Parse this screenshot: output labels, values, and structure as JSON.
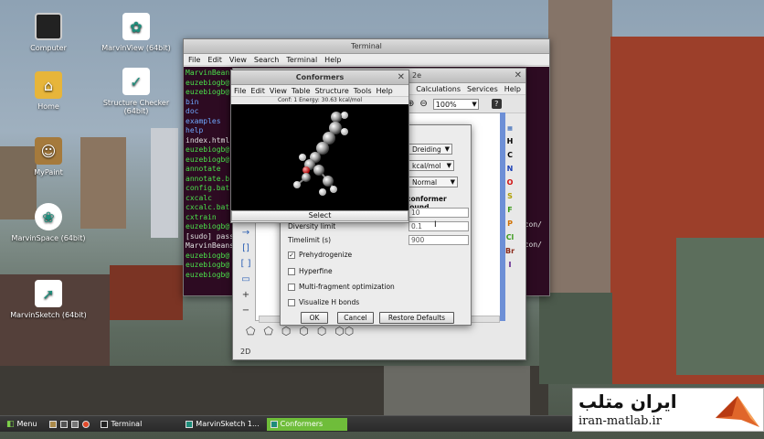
{
  "desktop_icons": [
    {
      "label": "Computer",
      "icon": "monitor-icon"
    },
    {
      "label": "MarvinView (64bit)",
      "icon": "marvinview-icon"
    },
    {
      "label": "Home",
      "icon": "folder-home-icon"
    },
    {
      "label": "Structure Checker (64bit)",
      "icon": "structure-checker-icon"
    },
    {
      "label": "MyPaint",
      "icon": "mypaint-icon"
    },
    {
      "label": "MarvinSpace (64bit)",
      "icon": "marvinspace-icon"
    },
    {
      "label": "MarvinSketch (64bit)",
      "icon": "marvinsketch-icon"
    }
  ],
  "terminal": {
    "title": "Terminal",
    "menu": [
      "File",
      "Edit",
      "View",
      "Search",
      "Terminal",
      "Help"
    ],
    "lines": [
      "MarvinBeans",
      "euzebiogb@",
      "euzebiogb@",
      "bin",
      "doc",
      "examples",
      "help",
      "index.html",
      "euzebiogb@",
      "euzebiogb@",
      "annotate",
      "annotate.b",
      "config.bat",
      "cxcalc",
      "cxcalc.bat",
      "cxtrain",
      "euzebiogb@",
      "[sudo] pass",
      "MarvinBeans",
      "euzebiogb@",
      "euzebiogb@",
      "euzebiogb@"
    ],
    "right_fragments": [
      "con/",
      "con/"
    ]
  },
  "marvinsketch": {
    "title_fragment": "2e",
    "menu_visible": [
      "Calculations",
      "Services",
      "Help"
    ],
    "zoom": "100%",
    "status_mode": "2D",
    "periodic_elements": [
      "H",
      "C",
      "N",
      "O",
      "S",
      "F",
      "P",
      "Cl",
      "Br",
      "I"
    ],
    "periodic_colors": [
      "#000000",
      "#000000",
      "#1a3fb5",
      "#d01010",
      "#b0a000",
      "#3a9a1a",
      "#d07000",
      "#3a9a1a",
      "#8a2a1a",
      "#5a1a8a"
    ]
  },
  "options": {
    "forcefield": "Dreiding",
    "energy_unit": "kcal/mol",
    "optimization": "Normal",
    "conformer_label": "conformer found",
    "max_conformers_value": "10",
    "diversity_label": "Diversity limit",
    "diversity_value": "0.1",
    "timelimit_label": "Timelimit (s)",
    "timelimit_value": "900",
    "checkboxes": [
      {
        "label": "Prehydrogenize",
        "checked": true
      },
      {
        "label": "Hyperfine",
        "checked": false
      },
      {
        "label": "Multi-fragment optimization",
        "checked": false
      },
      {
        "label": "Visualize H bonds",
        "checked": false
      }
    ],
    "ok_label": "OK",
    "cancel_label": "Cancel",
    "restore_label": "Restore Defaults"
  },
  "conformers": {
    "title": "Conformers",
    "menu": [
      "File",
      "Edit",
      "View",
      "Table",
      "Structure",
      "Tools",
      "Help"
    ],
    "info": "Conf: 1  Energy: 30.63 kcal/mol",
    "select_label": "Select"
  },
  "taskbar": {
    "menu_label": "Menu",
    "items": [
      {
        "label": "Terminal",
        "active": false
      },
      {
        "label": "MarvinSketch 1...",
        "active": false
      },
      {
        "label": "Conformers",
        "active": true
      }
    ]
  },
  "watermark": {
    "title": "ایران متلب",
    "url": "iran-matlab.ir"
  }
}
